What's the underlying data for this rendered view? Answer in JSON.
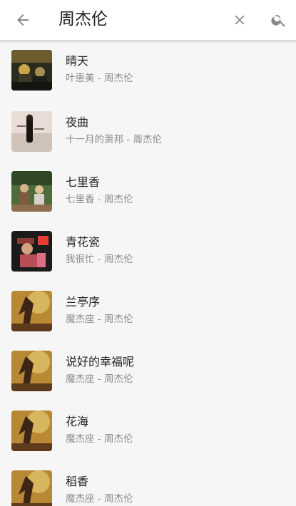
{
  "search": {
    "query": "周杰伦"
  },
  "icons": {
    "back": "back-arrow-icon",
    "clear": "close-icon",
    "search": "search-icon"
  },
  "colors": {
    "topbar_bg": "#ffffff",
    "list_bg": "#f6f6f6",
    "title_text": "#252525",
    "subtitle_text": "#8b8b8b",
    "icon_gray": "#8a8a8a"
  },
  "songs": [
    {
      "title": "晴天",
      "subtitle": "叶惠美 - 周杰伦",
      "cover": "album-cover-ye-hui-mei"
    },
    {
      "title": "夜曲",
      "subtitle": "十一月的萧邦 - 周杰伦",
      "cover": "album-cover-november-chopin"
    },
    {
      "title": "七里香",
      "subtitle": "七里香 - 周杰伦",
      "cover": "album-cover-qi-li-xiang"
    },
    {
      "title": "青花瓷",
      "subtitle": "我很忙 - 周杰伦",
      "cover": "album-cover-wo-hen-mang"
    },
    {
      "title": "兰亭序",
      "subtitle": "魔杰座 - 周杰伦",
      "cover": "album-cover-mo-jie-zuo"
    },
    {
      "title": "说好的幸福呢",
      "subtitle": "魔杰座 - 周杰伦",
      "cover": "album-cover-mo-jie-zuo"
    },
    {
      "title": "花海",
      "subtitle": "魔杰座 - 周杰伦",
      "cover": "album-cover-mo-jie-zuo"
    },
    {
      "title": "稻香",
      "subtitle": "魔杰座 - 周杰伦",
      "cover": "album-cover-mo-jie-zuo"
    }
  ]
}
